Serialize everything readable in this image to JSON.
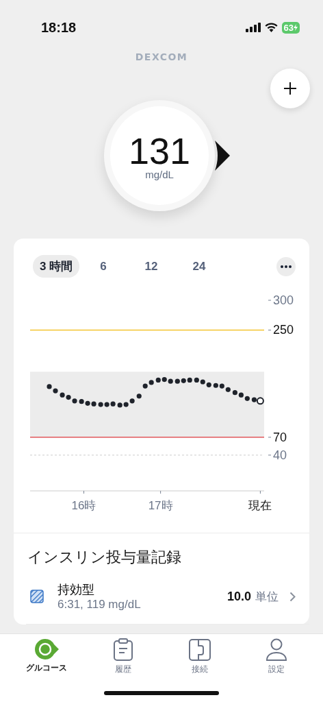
{
  "status_bar": {
    "time": "18:18",
    "battery": "63"
  },
  "header": {
    "logo": "DEXCOM"
  },
  "reading": {
    "value": "131",
    "unit": "mg/dL"
  },
  "range_tabs": [
    {
      "label": "3 時間",
      "selected": true
    },
    {
      "label": "6",
      "selected": false
    },
    {
      "label": "12",
      "selected": false
    },
    {
      "label": "24",
      "selected": false
    }
  ],
  "chart": {
    "chart_data": {
      "type": "scatter",
      "xlim": [
        15.3,
        18.35
      ],
      "ylim": [
        -20,
        300
      ],
      "xticks": [
        {
          "value": 16,
          "label": "16時"
        },
        {
          "value": 17,
          "label": "17時"
        },
        {
          "value": 18.3,
          "label": "現在"
        }
      ],
      "yticks": [
        300,
        250,
        70,
        40
      ],
      "x": [
        15.55,
        15.63,
        15.72,
        15.8,
        15.88,
        15.97,
        16.05,
        16.13,
        16.22,
        16.3,
        16.38,
        16.47,
        16.55,
        16.63,
        16.72,
        16.8,
        16.88,
        16.97,
        17.05,
        17.13,
        17.22,
        17.3,
        17.38,
        17.47,
        17.55,
        17.63,
        17.72,
        17.8,
        17.88,
        17.97,
        18.05,
        18.13,
        18.22,
        18.3
      ],
      "series": [
        {
          "color": "#1f232b",
          "values": [
            155,
            148,
            141,
            137,
            131,
            130,
            127,
            126,
            125,
            125,
            126,
            124,
            125,
            131,
            139,
            156,
            162,
            166,
            167,
            164,
            164,
            165,
            166,
            166,
            163,
            158,
            157,
            156,
            150,
            145,
            141,
            135,
            133,
            131
          ]
        }
      ],
      "bands": [
        {
          "axis": "y",
          "from": 70,
          "to": 180
        }
      ],
      "ref_lines": [
        {
          "axis": "y",
          "value": 250,
          "color": "#f4c430"
        },
        {
          "axis": "y",
          "value": 70,
          "color": "#e0575b"
        },
        {
          "axis": "y",
          "value": 40,
          "color": "#cccccc"
        }
      ]
    }
  },
  "insulin": {
    "title": "インスリン投与量記録",
    "entries": [
      {
        "name": "持効型",
        "detail": "6:31, 119 mg/dL",
        "amount": "10.0",
        "unit": "単位"
      }
    ]
  },
  "tab_bar": [
    {
      "kind": "glucose",
      "label": "グルコース",
      "selected": true
    },
    {
      "kind": "history",
      "label": "履歴",
      "selected": false
    },
    {
      "kind": "connect",
      "label": "接続",
      "selected": false
    },
    {
      "kind": "settings",
      "label": "設定",
      "selected": false
    }
  ]
}
